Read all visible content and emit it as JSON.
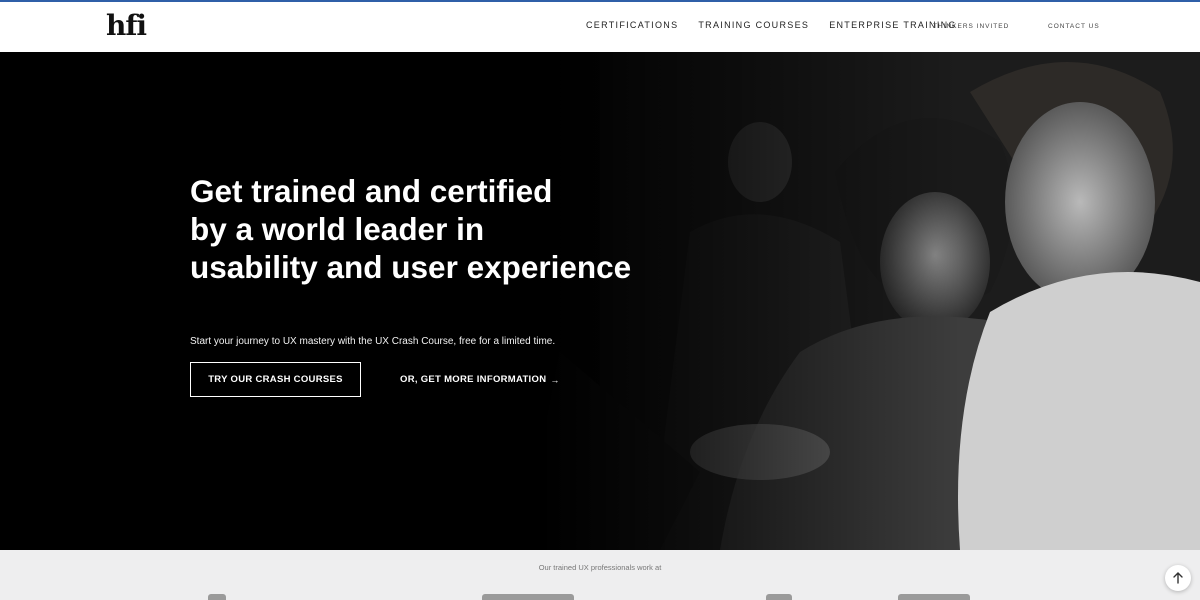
{
  "brand": {
    "logo_text": "hfi",
    "accent_color": "#2f5fa8"
  },
  "nav": {
    "main": [
      {
        "label": "CERTIFICATIONS"
      },
      {
        "label": "TRAINING COURSES"
      },
      {
        "label": "ENTERPRISE TRAINING"
      }
    ],
    "thinkers": "THINKERS INVITED",
    "contact": "CONTACT US"
  },
  "hero": {
    "title_lines": [
      "Get trained and certified",
      "by a world leader in",
      "usability and user experience"
    ],
    "subtitle": "Start your journey to UX mastery with the UX Crash Course, free for a limited time.",
    "primary_cta": "TRY OUR CRASH COURSES",
    "secondary_cta": "OR, GET MORE INFORMATION",
    "secondary_cta_icon": "arrow-right-icon"
  },
  "clients": {
    "caption": "Our trained UX professionals work at"
  },
  "scroll_top": {
    "icon": "arrow-up-icon"
  }
}
